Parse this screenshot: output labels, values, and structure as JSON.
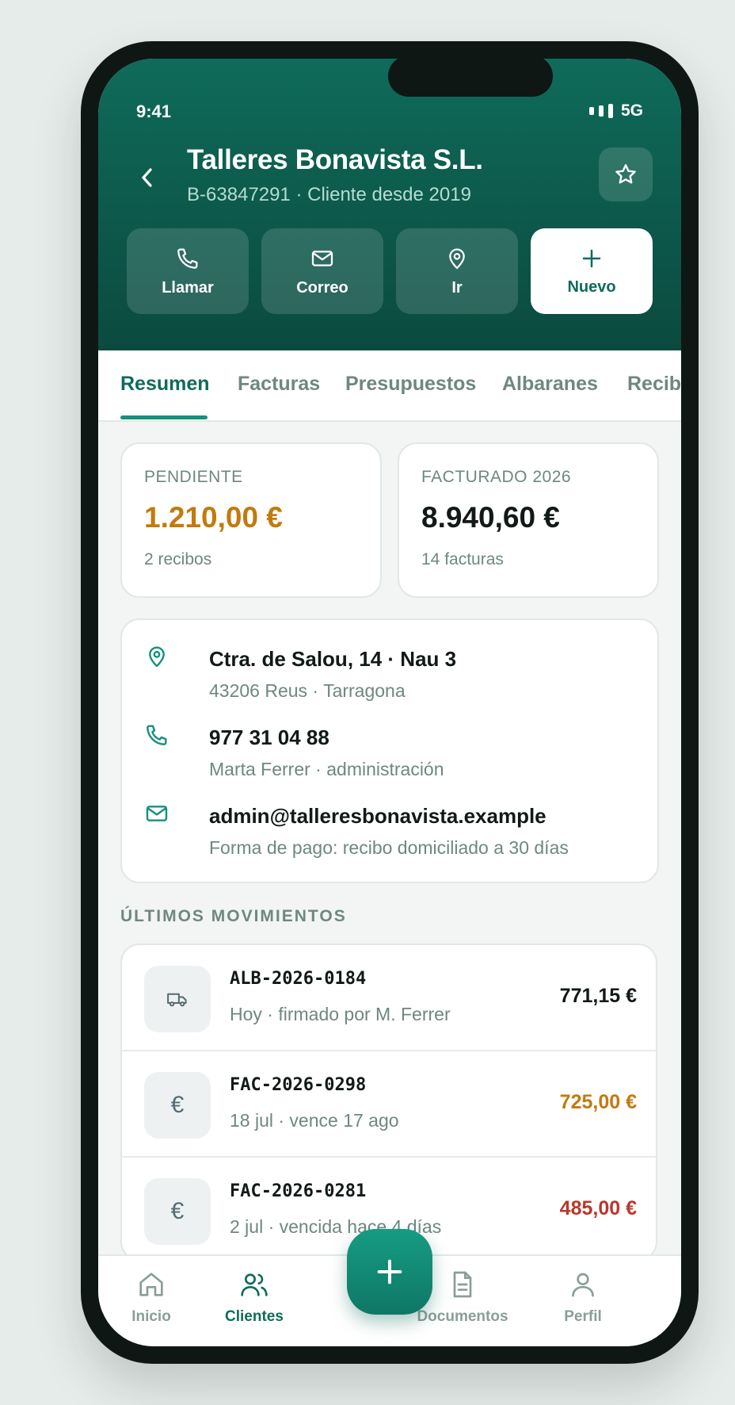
{
  "status": {
    "time": "9:41",
    "network": "5G"
  },
  "header": {
    "title": "Talleres Bonavista S.L.",
    "subtitle": "B-63847291 · Cliente desde 2019"
  },
  "actions": [
    {
      "label": "Llamar",
      "icon": "phone-icon"
    },
    {
      "label": "Correo",
      "icon": "mail-icon"
    },
    {
      "label": "Ir",
      "icon": "map-pin-icon"
    },
    {
      "label": "Nuevo",
      "icon": "plus-icon"
    }
  ],
  "tabs": [
    "Resumen",
    "Facturas",
    "Presupuestos",
    "Albaranes",
    "Recibos"
  ],
  "stats": {
    "pending": {
      "label": "PENDIENTE",
      "value": "1.210,00 €",
      "sub": "2 recibos"
    },
    "billed": {
      "label": "FACTURADO 2026",
      "value": "8.940,60 €",
      "sub": "14 facturas"
    }
  },
  "contact": {
    "address": {
      "main": "Ctra. de Salou, 14 · Nau 3",
      "sub": "43206 Reus · Tarragona"
    },
    "phone": {
      "main": "977 31 04 88",
      "sub": "Marta Ferrer · administración"
    },
    "email": {
      "main": "admin@talleresbonavista.example",
      "sub": "Forma de pago: recibo domiciliado a 30 días"
    }
  },
  "movements_title": "ÚLTIMOS MOVIMIENTOS",
  "movements": [
    {
      "code": "ALB-2026-0184",
      "sub": "Hoy · firmado por M. Ferrer",
      "amount": "771,15 €",
      "icon": "truck-icon",
      "color": "#111a17"
    },
    {
      "code": "FAC-2026-0298",
      "sub": "18 jul · vence 17 ago",
      "amount": "725,00 €",
      "icon": "euro-icon",
      "color": "#c27a0e"
    },
    {
      "code": "FAC-2026-0281",
      "sub": "2 jul · vencida hace 4 días",
      "amount": "485,00 €",
      "icon": "euro-icon",
      "color": "#b8382c"
    }
  ],
  "nav": {
    "home": "Inicio",
    "clients": "Clientes",
    "documents": "Documentos",
    "profile": "Perfil"
  },
  "colors": {
    "brand": "#0f6b5a",
    "pending": "#c27a0e",
    "overdue": "#b8382c"
  }
}
